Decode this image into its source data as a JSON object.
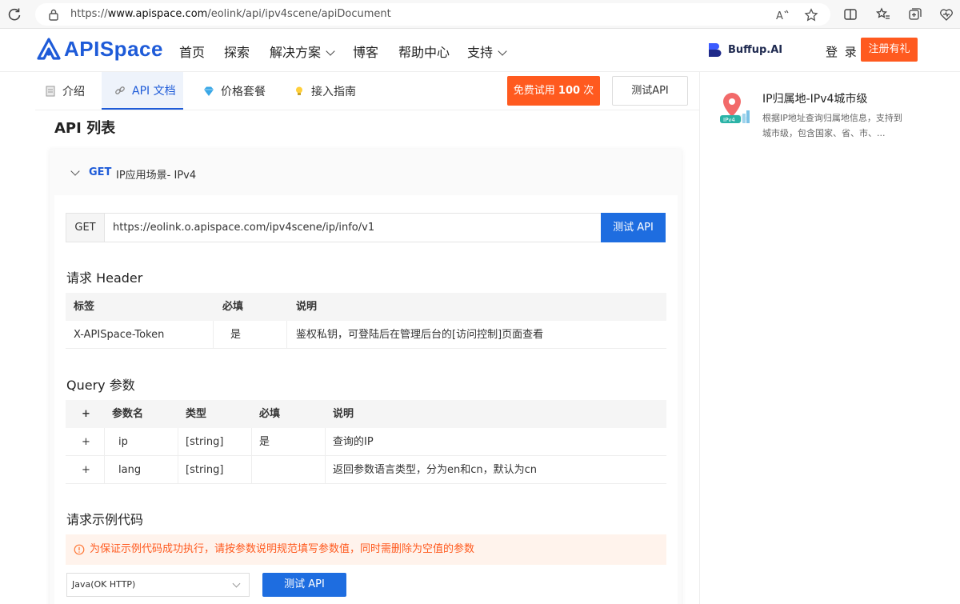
{
  "browser": {
    "url_prefix": "https://",
    "url_host": "www.apispace.com",
    "url_path": "/eolink/api/ipv4scene/apiDocument"
  },
  "header": {
    "logo_text": "APISpace",
    "nav": [
      "首页",
      "探索",
      "解决方案",
      "博客",
      "帮助中心",
      "支持"
    ],
    "buffup": "Buffup.AI",
    "login": "登 录",
    "register": "注册有礼"
  },
  "tabs": {
    "items": [
      "介绍",
      "API 文档",
      "价格套餐",
      "接入指南"
    ],
    "active": "API 文档",
    "trial_prefix": "免费试用",
    "trial_count": "100",
    "trial_suffix": "次",
    "test_api": "测试API"
  },
  "side_card": {
    "title": "IP归属地-IPv4城市级",
    "desc": "根据IP地址查询归属地信息，支持到城市级，包含国家、省、市、...",
    "icon_label": "IPv4"
  },
  "main": {
    "list_title": "API 列表",
    "api_method": "GET",
    "api_name": "IP应用场景- IPv4",
    "url_method": "GET",
    "url_endpoint": "https://eolink.o.apispace.com/ipv4scene/ip/info/v1",
    "url_test": "测试 API",
    "header_title": "请求 Header",
    "header_table": {
      "columns": [
        "标签",
        "必填",
        "说明"
      ],
      "rows": [
        [
          "X-APISpace-Token",
          "是",
          "鉴权私钥，可登陆后在管理后台的[访问控制]页面查看"
        ]
      ]
    },
    "query_title": "Query 参数",
    "query_table": {
      "columns": [
        "+",
        "参数名",
        "类型",
        "必填",
        "说明"
      ],
      "rows": [
        [
          "+",
          "ip",
          "[string]",
          "是",
          "查询的IP"
        ],
        [
          "+",
          "lang",
          "[string]",
          "",
          "返回参数语言类型，分为en和cn，默认为cn"
        ]
      ]
    },
    "code_title": "请求示例代码",
    "warning": "为保证示例代码成功执行，请按参数说明规范填写参数值，同时需删除为空值的参数",
    "lang_select": "Java(OK HTTP)",
    "bottom_test": "测试 API"
  },
  "colors": {
    "brand_blue": "#1e5bd8",
    "orange": "#ff5a1f"
  }
}
